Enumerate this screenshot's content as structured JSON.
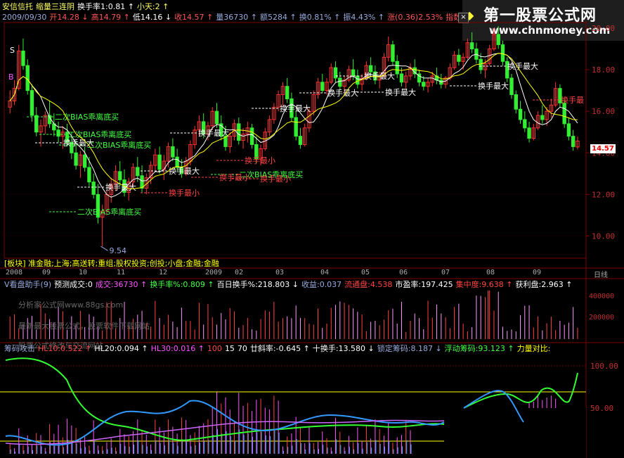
{
  "header": {
    "line1": [
      {
        "t": "安信信托",
        "c": "#ffff66"
      },
      {
        "t": "缩量三连阴",
        "c": "#ffff66"
      },
      {
        "t": "换手率1:0.81 ↑",
        "c": "#ffffff"
      },
      {
        "t": "小天:2 ↑",
        "c": "#ffff66"
      }
    ],
    "line2": [
      {
        "t": "2009/09/30",
        "c": "#9ad"
      },
      {
        "t": "开14.28 ↓",
        "c": "#ff5555"
      },
      {
        "t": "高14.79 ↑",
        "c": "#ff5555"
      },
      {
        "t": "低14.16 ↓",
        "c": "#ffffff"
      },
      {
        "t": "收14.57 ↑",
        "c": "#ff5555"
      },
      {
        "t": "量36730 ↑",
        "c": "#9ad"
      },
      {
        "t": "额5284 ↑",
        "c": "#9ad"
      },
      {
        "t": "换0.81% ↑",
        "c": "#9ad"
      },
      {
        "t": "振4.43% ↑",
        "c": "#9ad"
      },
      {
        "t": "涨(0.36)2.53%",
        "c": "#ff5555"
      },
      {
        "t": "指数(24.89)0.909",
        "c": "#ff5555"
      }
    ]
  },
  "logo": {
    "line1": "第一股票公式网",
    "line2": "www.chnmoney.com"
  },
  "price_axis": [
    "20.00",
    "18.00",
    "16.00",
    "14.00",
    "12.00",
    "10.00"
  ],
  "current_price": "14.57",
  "low_label": "9.54",
  "annotations": [
    {
      "t": "S",
      "c": "#fff"
    },
    {
      "t": "B",
      "c": "#f5f"
    },
    {
      "t": "二次BIAS乖离底买",
      "c": "#4f4"
    },
    {
      "t": "二次BIAS乖离底买",
      "c": "#4f4"
    },
    {
      "t": "二次BIAS乖离底买",
      "c": "#4f4"
    },
    {
      "t": "二次BIAS乖离底买",
      "c": "#4f4"
    },
    {
      "t": "二次BIAS乖离底买",
      "c": "#4f4"
    },
    {
      "t": "换手最大",
      "c": "#fff"
    },
    {
      "t": "换手最大",
      "c": "#fff"
    },
    {
      "t": "换手最大",
      "c": "#fff"
    },
    {
      "t": "换手最大",
      "c": "#fff"
    },
    {
      "t": "换手最大",
      "c": "#fff"
    },
    {
      "t": "换手最大",
      "c": "#fff"
    },
    {
      "t": "换手最大",
      "c": "#fff"
    },
    {
      "t": "换手最大",
      "c": "#fff"
    },
    {
      "t": "换手最大",
      "c": "#fff"
    },
    {
      "t": "换手最大",
      "c": "#fff"
    },
    {
      "t": "换手最小",
      "c": "#f44"
    },
    {
      "t": "换手最小",
      "c": "#f44"
    },
    {
      "t": "换手最小",
      "c": "#f44"
    },
    {
      "t": "换手最小",
      "c": "#f44"
    },
    {
      "t": "换手最",
      "c": "#f44"
    }
  ],
  "sector_line": "[板块] 准金融;上海;高送转;重组;股权投资;创投;小盘;金融;金融",
  "time_axis": [
    "2008",
    "09",
    "10",
    "11",
    "12",
    "2009",
    "02",
    "03",
    "04",
    "05",
    "06",
    "07",
    "08",
    "09",
    "日线"
  ],
  "vol_header": [
    {
      "t": "V看盘助手(9)",
      "c": "#9ad"
    },
    {
      "t": "预测成交:0",
      "c": "#fff"
    },
    {
      "t": "成交:36730 ↑",
      "c": "#f5f"
    },
    {
      "t": "换手率%:0.809 ↑",
      "c": "#4f4"
    },
    {
      "t": "百日换手%:218.803 ↓",
      "c": "#fff"
    },
    {
      "t": "收益:0.037",
      "c": "#9ad"
    },
    {
      "t": "流通盘:4.538",
      "c": "#f44"
    },
    {
      "t": "市盈率:197.425",
      "c": "#fff"
    },
    {
      "t": "集中度:9.638 ↑",
      "c": "#f44"
    },
    {
      "t": "获利盘:2.963 ↑",
      "c": "#fff"
    }
  ],
  "vol_axis": [
    "400000",
    "200000"
  ],
  "watermarks": [
    "分析家公式网www.88gs.com",
    "最新最大股票公式，股票软件下载网站",
    "股票公式修改与交流网站"
  ],
  "ind_header": [
    {
      "t": "筹码攻击",
      "c": "#9ad"
    },
    {
      "t": "HL10:0.522 ↑",
      "c": "#f44"
    },
    {
      "t": "HL20:0.094 ↑",
      "c": "#fff"
    },
    {
      "t": "HL30:0.016 ↑",
      "c": "#f5f"
    },
    {
      "t": "100",
      "c": "#f44"
    },
    {
      "t": "15",
      "c": "#fff"
    },
    {
      "t": "70",
      "c": "#fff"
    },
    {
      "t": "廿斜率:-0.645 ↑",
      "c": "#fff"
    },
    {
      "t": "十换手:13.580 ↓",
      "c": "#fff"
    },
    {
      "t": "锁定筹码:8.187 ↓",
      "c": "#9ad"
    },
    {
      "t": "浮动筹码:93.123 ↑",
      "c": "#4f4"
    },
    {
      "t": "力量对比:",
      "c": "#ff0"
    }
  ],
  "ind_axis": [
    "100.00",
    "50.00"
  ],
  "colors": {
    "up": "#ff3333",
    "down": "#33ee33",
    "bg": "#000000",
    "grid": "#800000",
    "text": "#c0c0c0"
  },
  "chart_data": {
    "type": "candlestick",
    "title": "安信信托",
    "ylim": [
      9.0,
      20.0
    ],
    "candles": [
      [
        16.2,
        17.0,
        15.9,
        16.5
      ],
      [
        16.5,
        17.5,
        16.3,
        17.1
      ],
      [
        17.1,
        19.2,
        17.0,
        18.9
      ],
      [
        18.9,
        19.5,
        18.0,
        18.2
      ],
      [
        18.2,
        18.5,
        16.8,
        17.0
      ],
      [
        17.0,
        17.3,
        15.5,
        15.8
      ],
      [
        15.8,
        16.2,
        14.8,
        15.0
      ],
      [
        15.0,
        15.6,
        14.3,
        15.3
      ],
      [
        15.3,
        16.0,
        14.9,
        15.8
      ],
      [
        15.8,
        16.5,
        15.2,
        15.4
      ],
      [
        15.4,
        15.9,
        14.8,
        15.1
      ],
      [
        15.1,
        15.5,
        14.5,
        14.8
      ],
      [
        14.8,
        15.3,
        14.2,
        15.0
      ],
      [
        15.0,
        15.4,
        14.3,
        14.5
      ],
      [
        14.5,
        15.0,
        13.7,
        14.0
      ],
      [
        14.0,
        14.6,
        13.2,
        13.4
      ],
      [
        13.4,
        14.1,
        12.8,
        13.9
      ],
      [
        13.9,
        14.3,
        13.1,
        13.3
      ],
      [
        13.3,
        13.8,
        12.4,
        12.6
      ],
      [
        12.6,
        13.0,
        11.8,
        12.0
      ],
      [
        12.0,
        12.5,
        10.6,
        10.9
      ],
      [
        10.9,
        11.5,
        9.5,
        11.2
      ],
      [
        11.2,
        12.2,
        11.0,
        12.0
      ],
      [
        12.0,
        12.8,
        11.6,
        12.5
      ],
      [
        12.5,
        13.4,
        12.2,
        13.1
      ],
      [
        13.1,
        13.6,
        12.4,
        12.7
      ],
      [
        12.7,
        13.2,
        11.9,
        12.1
      ],
      [
        12.1,
        12.8,
        11.7,
        12.6
      ],
      [
        12.6,
        13.5,
        12.4,
        13.3
      ],
      [
        13.3,
        13.8,
        12.6,
        12.9
      ],
      [
        12.9,
        13.4,
        12.1,
        12.3
      ],
      [
        12.3,
        13.0,
        12.0,
        12.8
      ],
      [
        12.8,
        13.6,
        12.5,
        13.4
      ],
      [
        13.4,
        14.2,
        13.1,
        13.9
      ],
      [
        13.9,
        14.3,
        13.0,
        13.2
      ],
      [
        13.2,
        13.9,
        12.7,
        13.6
      ],
      [
        13.6,
        14.5,
        13.3,
        14.3
      ],
      [
        14.3,
        14.7,
        13.6,
        13.8
      ],
      [
        13.8,
        14.2,
        13.1,
        13.3
      ],
      [
        13.3,
        13.7,
        12.8,
        13.0
      ],
      [
        13.0,
        13.8,
        12.9,
        13.6
      ],
      [
        13.6,
        14.6,
        13.4,
        14.4
      ],
      [
        14.4,
        15.3,
        14.2,
        15.1
      ],
      [
        15.1,
        15.8,
        14.8,
        15.5
      ],
      [
        15.5,
        15.9,
        14.7,
        14.9
      ],
      [
        14.9,
        15.5,
        14.6,
        15.3
      ],
      [
        15.3,
        16.2,
        15.1,
        16.0
      ],
      [
        16.0,
        16.4,
        15.2,
        15.4
      ],
      [
        15.4,
        15.8,
        14.6,
        14.8
      ],
      [
        14.8,
        15.3,
        14.1,
        14.3
      ],
      [
        14.3,
        15.0,
        14.0,
        14.8
      ],
      [
        14.8,
        15.6,
        14.6,
        15.4
      ],
      [
        15.4,
        15.7,
        14.4,
        14.6
      ],
      [
        14.6,
        15.2,
        14.2,
        14.9
      ],
      [
        14.9,
        15.5,
        14.5,
        15.2
      ],
      [
        15.2,
        15.4,
        14.2,
        14.4
      ],
      [
        14.4,
        14.8,
        13.5,
        13.7
      ],
      [
        13.7,
        14.4,
        13.4,
        14.2
      ],
      [
        14.2,
        15.2,
        14.1,
        15.0
      ],
      [
        15.0,
        15.8,
        14.8,
        15.6
      ],
      [
        15.6,
        16.4,
        15.4,
        16.2
      ],
      [
        16.2,
        17.0,
        16.0,
        16.8
      ],
      [
        16.8,
        17.4,
        16.2,
        17.2
      ],
      [
        17.2,
        17.6,
        16.4,
        16.6
      ],
      [
        16.6,
        16.9,
        15.5,
        15.7
      ],
      [
        15.7,
        16.0,
        14.6,
        14.8
      ],
      [
        14.8,
        15.2,
        14.2,
        14.4
      ],
      [
        14.4,
        15.4,
        14.3,
        15.2
      ],
      [
        15.2,
        16.2,
        15.0,
        16.0
      ],
      [
        16.0,
        17.0,
        15.8,
        16.8
      ],
      [
        16.8,
        17.6,
        16.6,
        17.4
      ],
      [
        17.4,
        17.8,
        16.9,
        17.0
      ],
      [
        17.0,
        17.6,
        16.8,
        17.4
      ],
      [
        17.4,
        18.3,
        17.3,
        18.1
      ],
      [
        18.1,
        18.4,
        17.4,
        17.6
      ],
      [
        17.6,
        17.9,
        17.0,
        17.2
      ],
      [
        17.2,
        17.7,
        16.9,
        17.5
      ],
      [
        17.5,
        18.2,
        17.4,
        18.0
      ],
      [
        18.0,
        18.5,
        17.5,
        17.7
      ],
      [
        17.7,
        18.0,
        17.1,
        17.3
      ],
      [
        17.3,
        17.8,
        17.0,
        17.6
      ],
      [
        17.6,
        18.4,
        17.5,
        18.2
      ],
      [
        18.2,
        18.6,
        17.7,
        17.9
      ],
      [
        17.9,
        18.2,
        17.3,
        17.5
      ],
      [
        17.5,
        17.9,
        17.1,
        17.7
      ],
      [
        17.7,
        18.8,
        17.6,
        18.6
      ],
      [
        18.6,
        19.6,
        18.4,
        19.2
      ],
      [
        19.2,
        19.4,
        18.2,
        18.4
      ],
      [
        18.4,
        18.7,
        17.6,
        17.8
      ],
      [
        17.8,
        18.1,
        17.2,
        17.4
      ],
      [
        17.4,
        17.9,
        17.1,
        17.7
      ],
      [
        17.7,
        18.3,
        17.5,
        18.1
      ],
      [
        18.1,
        18.5,
        17.6,
        17.8
      ],
      [
        17.8,
        18.0,
        17.2,
        17.4
      ],
      [
        17.4,
        17.7,
        17.0,
        17.2
      ],
      [
        17.2,
        17.6,
        16.9,
        17.4
      ],
      [
        17.4,
        17.9,
        17.2,
        17.7
      ],
      [
        17.7,
        18.1,
        17.3,
        17.5
      ],
      [
        17.5,
        17.8,
        17.1,
        17.3
      ],
      [
        17.3,
        17.7,
        17.1,
        17.6
      ],
      [
        17.6,
        18.3,
        17.5,
        18.1
      ],
      [
        18.1,
        18.9,
        18.0,
        18.7
      ],
      [
        18.7,
        19.0,
        18.2,
        18.4
      ],
      [
        18.4,
        18.8,
        18.0,
        18.6
      ],
      [
        18.6,
        19.5,
        18.5,
        19.3
      ],
      [
        19.3,
        19.8,
        18.8,
        19.0
      ],
      [
        19.0,
        19.3,
        18.3,
        18.5
      ],
      [
        18.5,
        18.8,
        17.8,
        18.0
      ],
      [
        18.0,
        18.5,
        17.6,
        18.3
      ],
      [
        18.3,
        19.2,
        18.2,
        19.0
      ],
      [
        19.0,
        20.0,
        18.9,
        19.7
      ],
      [
        19.7,
        20.1,
        19.0,
        19.2
      ],
      [
        19.2,
        19.4,
        18.2,
        18.4
      ],
      [
        18.4,
        18.6,
        17.4,
        17.6
      ],
      [
        17.6,
        17.8,
        16.6,
        16.8
      ],
      [
        16.8,
        17.0,
        15.9,
        16.1
      ],
      [
        16.1,
        16.5,
        15.4,
        15.6
      ],
      [
        15.6,
        16.0,
        15.0,
        15.2
      ],
      [
        15.2,
        15.5,
        14.5,
        14.7
      ],
      [
        14.7,
        15.4,
        14.6,
        15.2
      ],
      [
        15.2,
        16.0,
        15.1,
        15.8
      ],
      [
        15.8,
        16.3,
        15.4,
        15.6
      ],
      [
        15.6,
        16.2,
        15.3,
        16.0
      ],
      [
        16.0,
        16.6,
        15.7,
        16.3
      ],
      [
        16.3,
        17.4,
        16.2,
        17.1
      ],
      [
        17.1,
        17.3,
        16.2,
        16.4
      ],
      [
        16.4,
        16.6,
        15.2,
        15.4
      ],
      [
        15.4,
        15.7,
        14.6,
        14.8
      ],
      [
        14.8,
        15.1,
        14.1,
        14.3
      ],
      [
        14.28,
        14.79,
        14.16,
        14.57
      ]
    ]
  }
}
